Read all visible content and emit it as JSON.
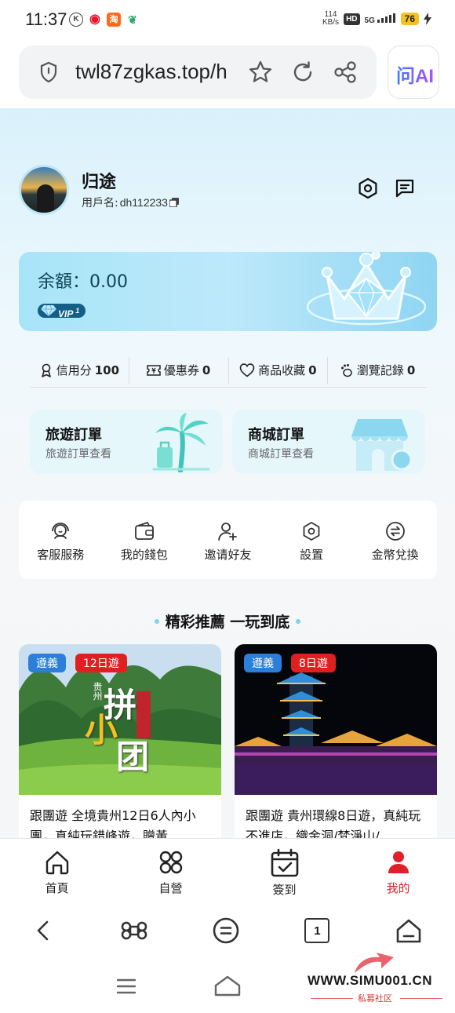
{
  "status_bar": {
    "time": "11:37",
    "net_speed_top": "114",
    "net_speed_bottom": "KB/s",
    "hd": "HD",
    "signal": "5G",
    "battery": "76"
  },
  "browser": {
    "url": "twl87zgkas.top/h",
    "ai_button": "问AI"
  },
  "profile": {
    "name": "归途",
    "username_label": "用戶名:",
    "username": "dh112233"
  },
  "balance": {
    "text": "余額：0.00",
    "vip_label": "VIP",
    "vip_level": "1"
  },
  "stats": [
    {
      "label": "信用分",
      "value": "100",
      "icon": "credit-icon"
    },
    {
      "label": "優惠券",
      "value": "0",
      "icon": "coupon-icon"
    },
    {
      "label": "商品收藏",
      "value": "0",
      "icon": "heart-icon"
    },
    {
      "label": "瀏覽記錄",
      "value": "0",
      "icon": "footprint-icon"
    }
  ],
  "orders": [
    {
      "title": "旅遊訂單",
      "subtitle": "旅遊訂單查看"
    },
    {
      "title": "商城訂單",
      "subtitle": "商城訂單查看"
    }
  ],
  "functions": [
    {
      "label": "客服服務",
      "icon": "customer-service-icon"
    },
    {
      "label": "我的錢包",
      "icon": "wallet-icon"
    },
    {
      "label": "邀请好友",
      "icon": "invite-friend-icon"
    },
    {
      "label": "設置",
      "icon": "settings-icon"
    },
    {
      "label": "金幣兌換",
      "icon": "exchange-icon"
    }
  ],
  "recommend": {
    "title": "精彩推薦 一玩到底",
    "products": [
      {
        "tag_city": "遵義",
        "tag_days": "12日遊",
        "title": "跟團遊 全境貴州12日6人內小團，真純玩錯峰遊，贈黃…",
        "art_text_1": "拼",
        "art_text_2": "小",
        "art_text_3": "团",
        "art_small": "贵州"
      },
      {
        "tag_city": "遵義",
        "tag_days": "8日遊",
        "title": "跟團遊 貴州環線8日遊，真純玩不進店，織金洞/梵淨山/…"
      }
    ]
  },
  "tab_bar": [
    {
      "label": "首頁",
      "icon": "home-icon",
      "active": false
    },
    {
      "label": "自營",
      "icon": "self-operated-icon",
      "active": false
    },
    {
      "label": "簽到",
      "icon": "checkin-icon",
      "active": false
    },
    {
      "label": "我的",
      "icon": "profile-icon",
      "active": true
    }
  ],
  "browser_toolbar": {
    "tab_count": "1"
  },
  "watermark": {
    "text": "WWW.SIMU001.CN",
    "subtitle": "私募社区"
  },
  "colors": {
    "accent_red": "#e0202a",
    "card_blue": "#a8e4f8",
    "tag_blue": "#2b7fd9",
    "tag_red": "#e02020"
  }
}
